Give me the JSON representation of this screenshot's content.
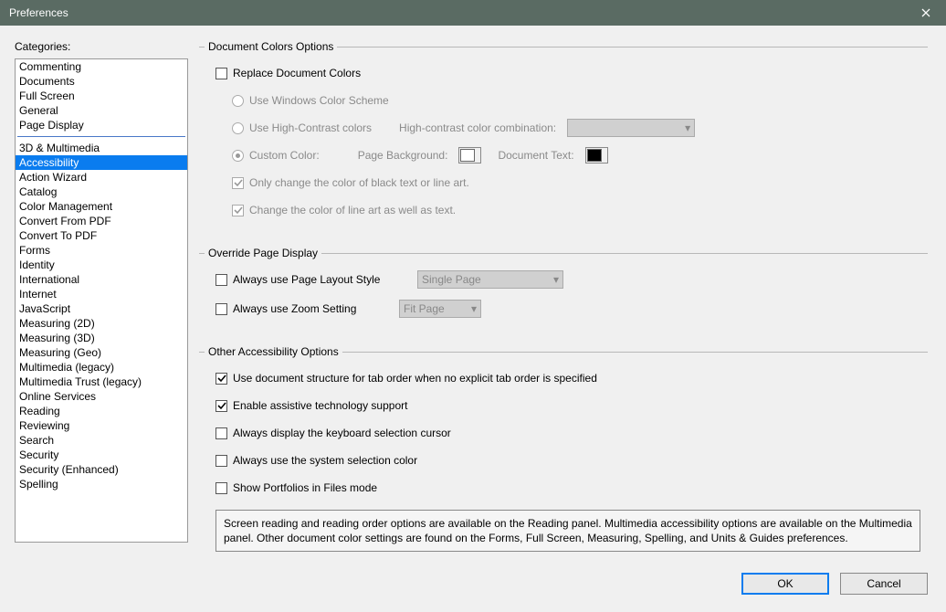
{
  "title": "Preferences",
  "sidebar": {
    "label": "Categories:",
    "items": [
      "Commenting",
      "Documents",
      "Full Screen",
      "General",
      "Page Display",
      "---",
      "3D & Multimedia",
      "Accessibility",
      "Action Wizard",
      "Catalog",
      "Color Management",
      "Convert From PDF",
      "Convert To PDF",
      "Forms",
      "Identity",
      "International",
      "Internet",
      "JavaScript",
      "Measuring (2D)",
      "Measuring (3D)",
      "Measuring (Geo)",
      "Multimedia (legacy)",
      "Multimedia Trust (legacy)",
      "Online Services",
      "Reading",
      "Reviewing",
      "Search",
      "Security",
      "Security (Enhanced)",
      "Spelling"
    ],
    "selected": "Accessibility"
  },
  "sections": {
    "docColors": {
      "legend": "Document Colors Options",
      "replace": "Replace Document Colors",
      "winScheme": "Use Windows Color Scheme",
      "highContrast": "Use High-Contrast colors",
      "highContrastComboLabel": "High-contrast color combination:",
      "customColor": "Custom Color:",
      "pageBackground": "Page Background:",
      "documentText": "Document Text:",
      "onlyBlack": "Only change the color of black text or line art.",
      "lineArt": "Change the color of line art as well as text.",
      "bgColor": "#ffffff",
      "textColor": "#000000"
    },
    "override": {
      "legend": "Override Page Display",
      "pageLayout": "Always use Page Layout Style",
      "pageLayoutValue": "Single Page",
      "zoom": "Always use Zoom Setting",
      "zoomValue": "Fit Page"
    },
    "other": {
      "legend": "Other Accessibility Options",
      "tabOrder": "Use document structure for tab order when no explicit tab order is specified",
      "assistive": "Enable assistive technology support",
      "keyboardCursor": "Always display the keyboard selection cursor",
      "systemColor": "Always use the system selection color",
      "portfolios": "Show Portfolios in Files mode",
      "info": "Screen reading and reading order options are available on the Reading panel. Multimedia accessibility options are available on the Multimedia panel. Other document color settings are found on the Forms, Full Screen, Measuring, Spelling, and Units & Guides preferences."
    }
  },
  "buttons": {
    "ok": "OK",
    "cancel": "Cancel"
  }
}
